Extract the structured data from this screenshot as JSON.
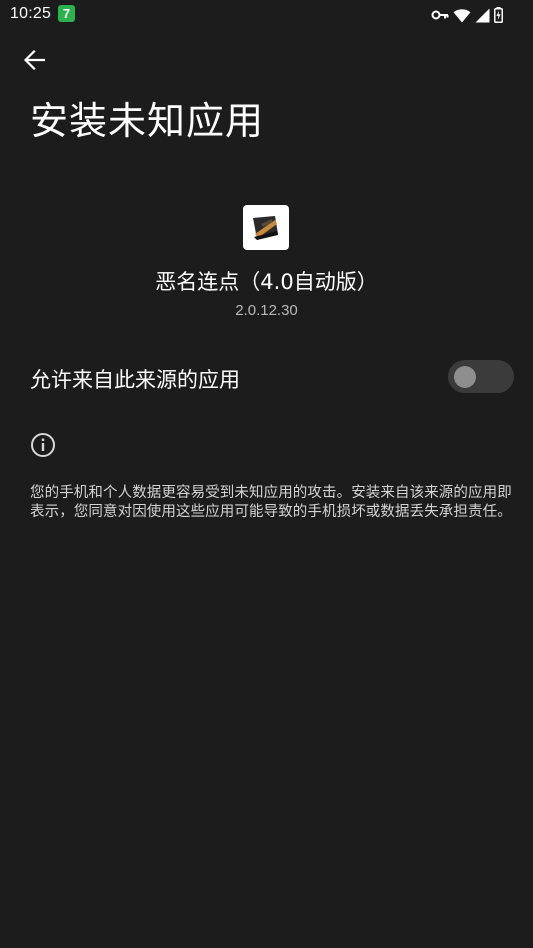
{
  "status_bar": {
    "time": "10:25",
    "badge": "7",
    "icons": [
      "vpn-key-icon",
      "wifi-icon",
      "cell-signal-icon",
      "battery-charging-icon"
    ]
  },
  "header": {
    "back_icon": "arrow-back-icon",
    "title": "安装未知应用"
  },
  "app": {
    "name": "恶名连点（4.0自动版）",
    "version": "2.0.12.30"
  },
  "permission": {
    "label": "允许来自此来源的应用",
    "enabled": false
  },
  "warning": {
    "icon": "info-icon",
    "text": "您的手机和个人数据更容易受到未知应用的攻击。安装来自该来源的应用即表示，您同意对因使用这些应用可能导致的手机损坏或数据丢失承担责任。"
  },
  "colors": {
    "background": "#1c1c1c",
    "switch_track_off": "#3b3b3b",
    "switch_thumb_off": "#8e8e8e",
    "badge": "#2bb24c"
  }
}
